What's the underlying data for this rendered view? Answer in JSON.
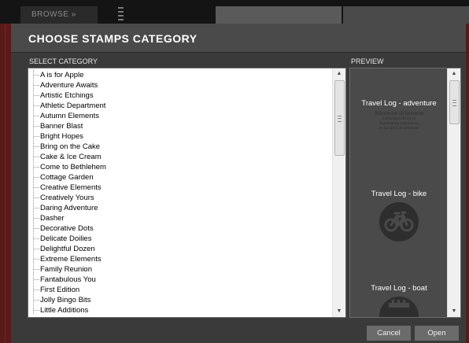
{
  "app": {
    "browse_tab_label": "BROWSE  »"
  },
  "dialog": {
    "title": "CHOOSE STAMPS CATEGORY",
    "select_category_label": "SELECT CATEGORY",
    "preview_label": "PREVIEW",
    "categories": [
      "A is for Apple",
      "Adventure Awaits",
      "Artistic Etchings",
      "Athletic Department",
      "Autumn Elements",
      "Banner Blast",
      "Bright Hopes",
      "Bring on the Cake",
      "Cake & Ice Cream",
      "Come to Bethlehem",
      "Cottage Garden",
      "Creative Elements",
      "Creatively Yours",
      "Daring Adventure",
      "Dasher",
      "Decorative Dots",
      "Delicate Doilies",
      "Delightful Dozen",
      "Extreme Elements",
      "Family Reunion",
      "Fantabulous You",
      "First Edition",
      "Jolly Bingo Bits",
      "Little Additions"
    ],
    "preview_items": [
      {
        "label": "Travel Log - adventure",
        "text_lines": [
          "Adventure  ob'tisement",
          "Enthusiasm for travel",
          "Exhilarating experiences",
          "In the spirit of adventure"
        ]
      },
      {
        "label": "Travel Log - bike",
        "icon": "bicycle-icon"
      },
      {
        "label": "Travel Log - boat",
        "icon": "boat-icon"
      }
    ],
    "buttons": {
      "cancel": "Cancel",
      "open": "Open"
    }
  },
  "colors": {
    "dialog_bg": "#3a3a3a",
    "header_bg": "#4a4a4a",
    "accent_red": "#5a1a1a",
    "button_bg": "#6b6b6b"
  }
}
